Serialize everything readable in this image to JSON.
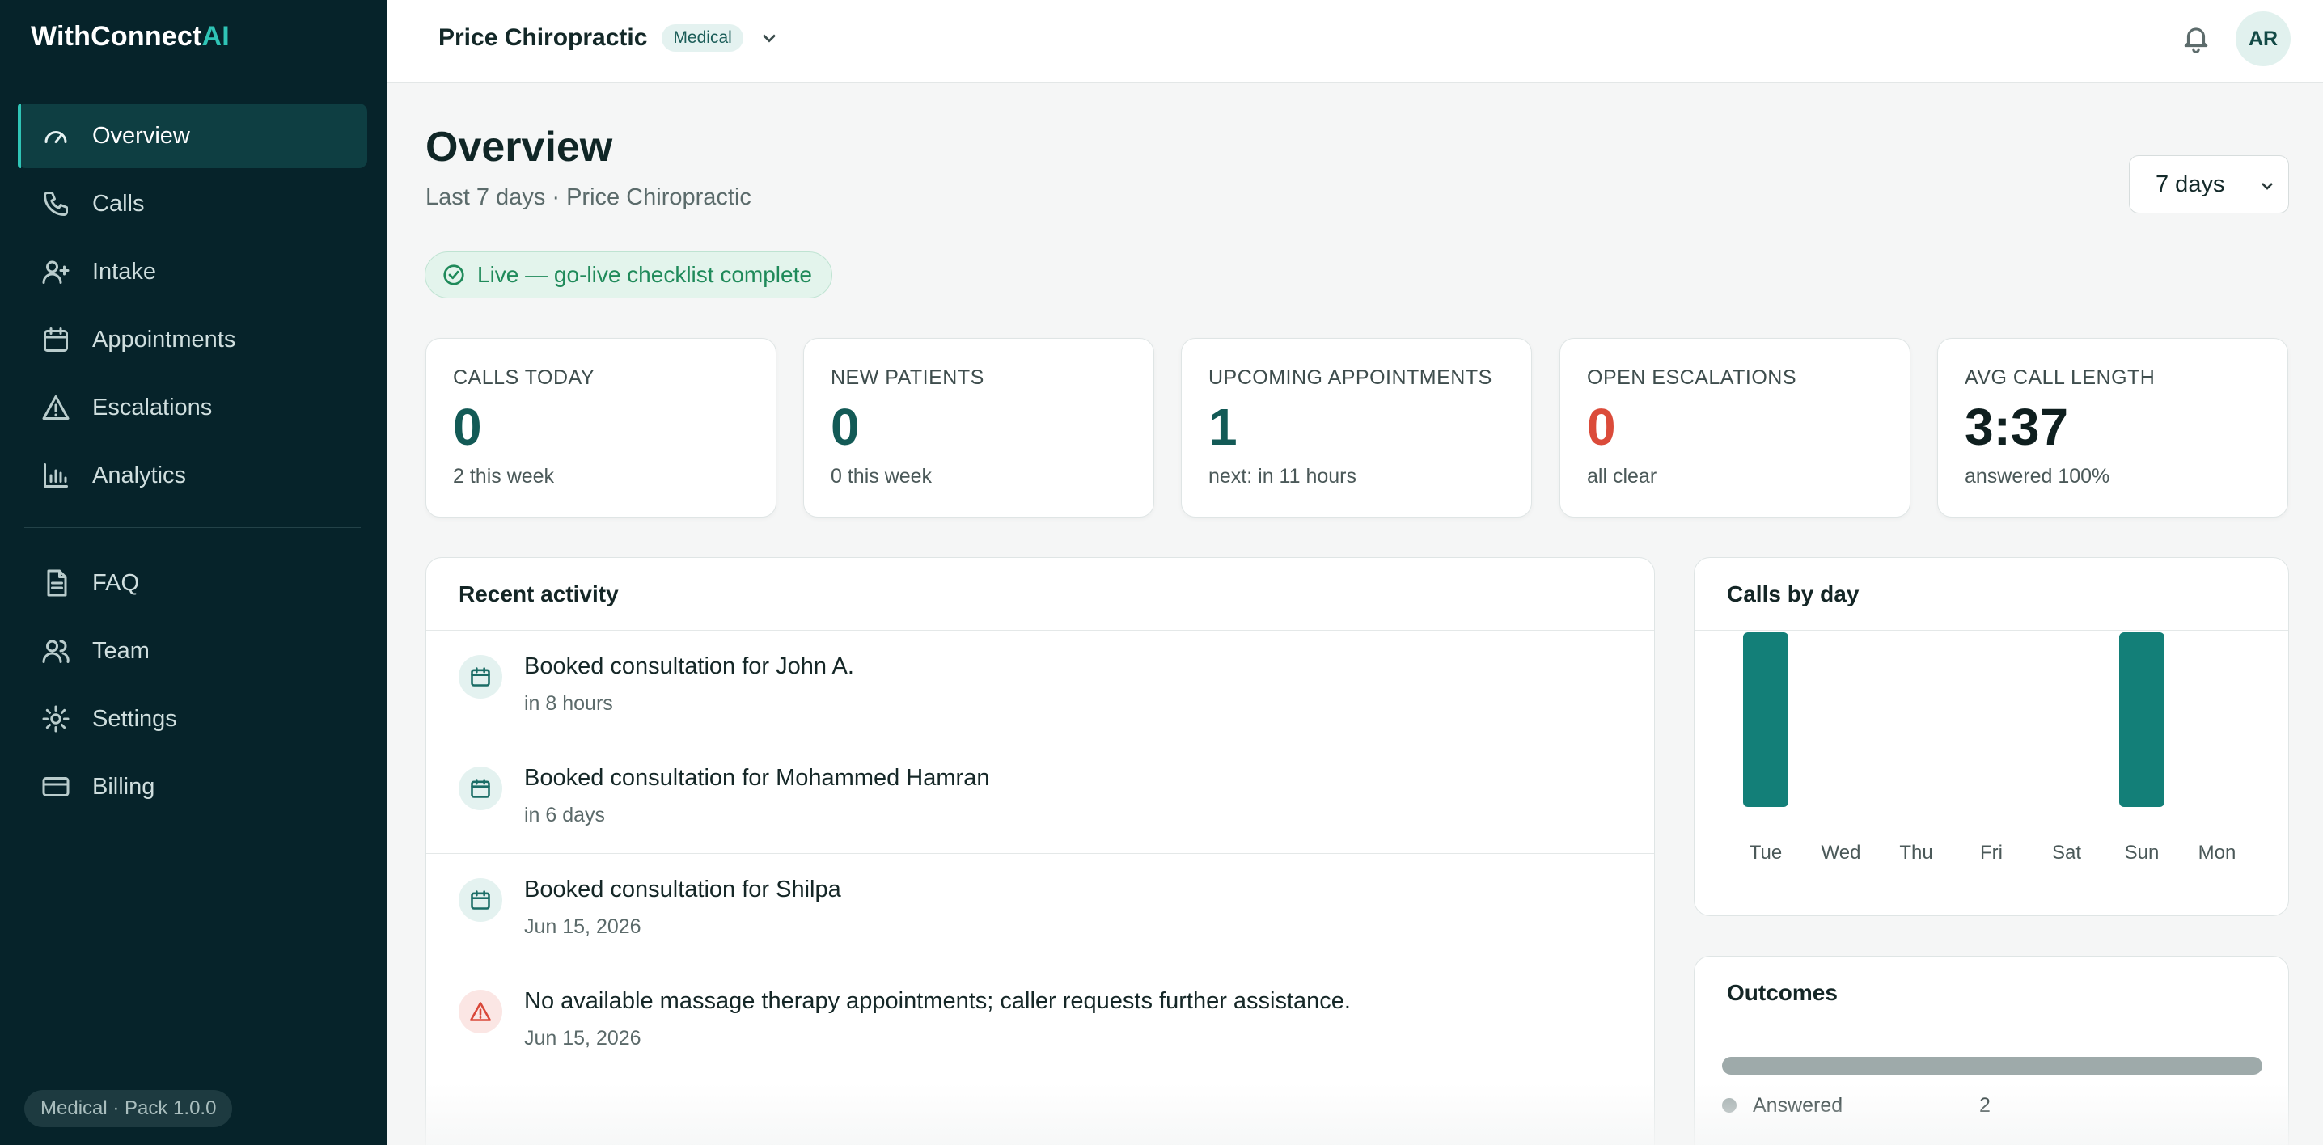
{
  "brand": {
    "name": "WithConnect",
    "suffix": "AI"
  },
  "sidebar": {
    "items": [
      {
        "label": "Overview",
        "icon": "gauge-icon",
        "active": true
      },
      {
        "label": "Calls",
        "icon": "phone-icon"
      },
      {
        "label": "Intake",
        "icon": "user-plus-icon"
      },
      {
        "label": "Appointments",
        "icon": "calendar-icon"
      },
      {
        "label": "Escalations",
        "icon": "alert-triangle-icon"
      },
      {
        "label": "Analytics",
        "icon": "bar-chart-icon"
      }
    ],
    "secondary": [
      {
        "label": "FAQ",
        "icon": "document-icon"
      },
      {
        "label": "Team",
        "icon": "users-icon"
      },
      {
        "label": "Settings",
        "icon": "gear-icon"
      },
      {
        "label": "Billing",
        "icon": "credit-card-icon"
      }
    ],
    "pack": "Medical · Pack 1.0.0"
  },
  "header": {
    "practice": "Price Chiropractic",
    "vertical": "Medical",
    "avatar_initials": "AR"
  },
  "page": {
    "title": "Overview",
    "subtitle": "Last 7 days · Price Chiropractic",
    "range": "7 days",
    "status": "Live — go-live checklist complete"
  },
  "kpis": [
    {
      "label": "CALLS TODAY",
      "value": "0",
      "sub": "2 this week"
    },
    {
      "label": "NEW PATIENTS",
      "value": "0",
      "sub": "0 this week"
    },
    {
      "label": "UPCOMING APPOINTMENTS",
      "value": "1",
      "sub": "next: in 11 hours"
    },
    {
      "label": "OPEN ESCALATIONS",
      "value": "0",
      "sub": "all clear"
    },
    {
      "label": "AVG CALL LENGTH",
      "value": "3:37",
      "sub": "answered 100%"
    }
  ],
  "activity": {
    "title": "Recent activity",
    "items": [
      {
        "title": "Booked consultation for John A.",
        "time": "in 8 hours",
        "icon": "calendar-icon"
      },
      {
        "title": "Booked consultation for Mohammed Hamran",
        "time": "in 6 days",
        "icon": "calendar-icon"
      },
      {
        "title": "Booked consultation for Shilpa",
        "time": "Jun 15, 2026",
        "icon": "calendar-icon"
      },
      {
        "title": "No available massage therapy appointments; caller requests further assistance.",
        "time": "Jun 15, 2026",
        "icon": "alert-triangle-icon"
      }
    ]
  },
  "calls_by_day": {
    "title": "Calls by day",
    "bar_color": "#137f78"
  },
  "chart_data": {
    "type": "bar",
    "title": "Calls by day",
    "categories": [
      "Tue",
      "Wed",
      "Thu",
      "Fri",
      "Sat",
      "Sun",
      "Mon"
    ],
    "values": [
      1,
      0,
      0,
      0,
      0,
      1,
      0
    ],
    "ylim": [
      0,
      1
    ],
    "grid": false,
    "xlabel": "",
    "ylabel": ""
  },
  "outcomes": {
    "title": "Outcomes",
    "items": [
      {
        "label": "Answered",
        "count": "2",
        "color": "#9eaaaa"
      }
    ]
  },
  "colors": {
    "accent": "#2fc4b6",
    "sidebar_bg": "#06232a",
    "danger": "#db4b3a",
    "success": "#1f8a5a"
  }
}
